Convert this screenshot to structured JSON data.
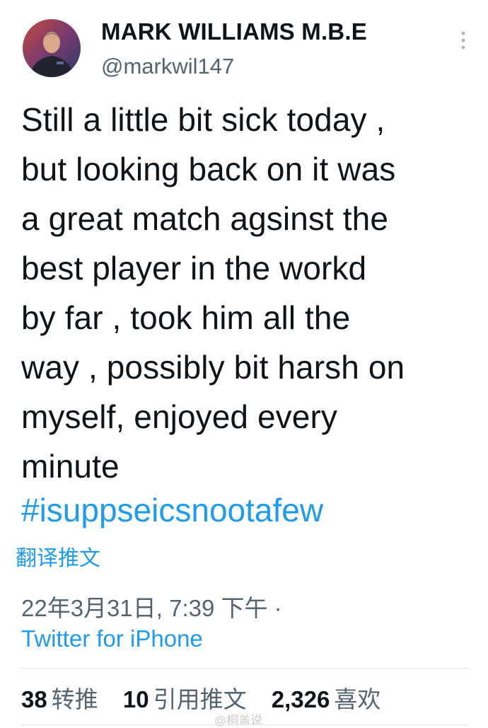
{
  "header": {
    "display_name": "MARK WILLIAMS M.B.E",
    "handle": "@markwil147",
    "avatar_icon": "profile-photo",
    "more_icon": "vertical-ellipsis-icon"
  },
  "tweet": {
    "text": "Still a little bit sick today ,\nbut looking back on it was\na great match agsinst the\nbest player in the workd\nby far , took him all the\nway , possibly bit harsh on\nmyself, enjoyed every\nminute",
    "hashtag": "#isuppseicsnootafew",
    "translate_label": "翻译推文"
  },
  "meta": {
    "timestamp": "22年3月31日, 7:39 下午 ·",
    "client": "Twitter for iPhone"
  },
  "stats": {
    "retweets_count": "38",
    "retweets_label": "转推",
    "quotes_count": "10",
    "quotes_label": "引用推文",
    "likes_count": "2,326",
    "likes_label": "喜欢"
  },
  "watermark": "@桐盖说",
  "colors": {
    "link": "#1d9bf0",
    "text": "#0f1419",
    "secondary": "#536471"
  }
}
